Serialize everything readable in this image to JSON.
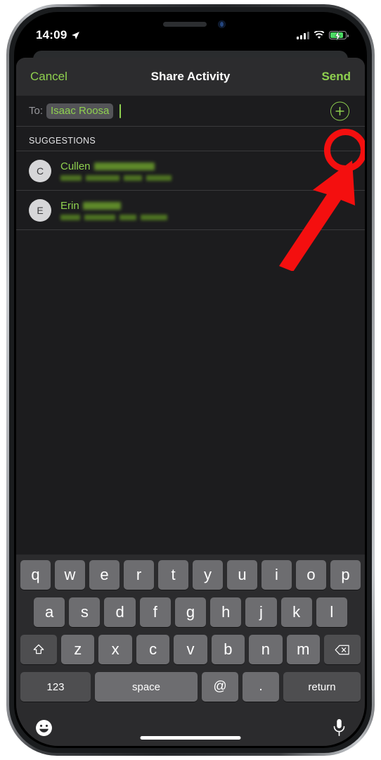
{
  "status_bar": {
    "time": "14:09",
    "location_icon": "location-arrow-icon",
    "cellular_icon": "cellular-signal-icon",
    "wifi_icon": "wifi-icon",
    "battery_icon": "battery-charging-icon",
    "battery_state": "charging"
  },
  "nav_bar": {
    "cancel_label": "Cancel",
    "title": "Share Activity",
    "send_label": "Send"
  },
  "to_field": {
    "label": "To:",
    "recipient": "Isaac Roosa",
    "add_contact_icon": "plus-circle-icon"
  },
  "suggestions": {
    "header": "SUGGESTIONS",
    "items": [
      {
        "avatar_initial": "C",
        "first_name": "Cullen",
        "last_name_redacted": true,
        "subtitle_redacted": true
      },
      {
        "avatar_initial": "E",
        "first_name": "Erin",
        "last_name_redacted": true,
        "subtitle_redacted": true
      }
    ]
  },
  "keyboard": {
    "row1": [
      "q",
      "w",
      "e",
      "r",
      "t",
      "y",
      "u",
      "i",
      "o",
      "p"
    ],
    "row2": [
      "a",
      "s",
      "d",
      "f",
      "g",
      "h",
      "j",
      "k",
      "l"
    ],
    "row3": [
      "z",
      "x",
      "c",
      "v",
      "b",
      "n",
      "m"
    ],
    "shift_icon": "shift-arrow-icon",
    "backspace_icon": "backspace-delete-icon",
    "numbers_label": "123",
    "space_label": "space",
    "at_label": "@",
    "period_label": ".",
    "return_label": "return",
    "emoji_icon": "emoji-smiley-icon",
    "dictation_icon": "microphone-icon"
  },
  "annotations": {
    "highlight_color": "#f40f0f",
    "ring_target": "add-contact-button",
    "arrow_points_to": "add-contact-button"
  },
  "colors": {
    "accent_green": "#8fd14f",
    "sheet_bg": "#1c1c1e",
    "nav_bg": "#2c2c2e",
    "key_bg": "#6d6d70",
    "key_func_bg": "#4e4e50",
    "battery_green": "#4cd964"
  }
}
